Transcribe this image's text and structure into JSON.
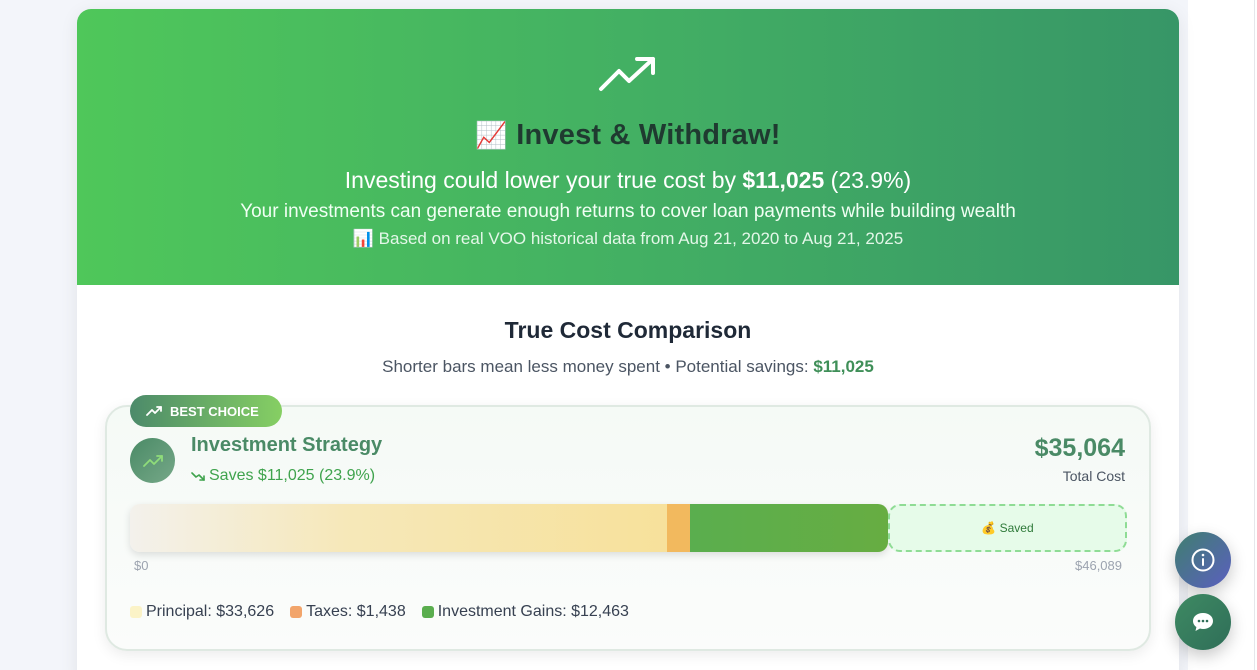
{
  "hero": {
    "emoji": "📈",
    "title": "Invest & Withdraw!",
    "line1_prefix": "Investing could lower your true cost by",
    "line1_amount": "$11,025",
    "line1_pct": "(23.9%)",
    "line2": "Your investments can generate enough returns to cover loan payments while building wealth",
    "line3": "📊 Based on real VOO historical data from Aug 21, 2020 to Aug 21, 2025"
  },
  "comparison": {
    "title": "True Cost Comparison",
    "subtitle": "Shorter bars mean less money spent • Potential savings:",
    "subtitle_amount": "$11,025"
  },
  "strategy": {
    "badge": "BEST CHOICE",
    "name": "Investment Strategy",
    "saves": "Saves $11,025 (23.9%)",
    "cost": "$35,064",
    "cost_label": "Total Cost",
    "saved_label": "💰 Saved",
    "axis_min": "$0",
    "axis_max": "$46,089"
  },
  "bar_values": {
    "max": 46089,
    "principal": 33626,
    "taxes": 1438,
    "gains": 12463,
    "saved": 11025
  },
  "legend": [
    {
      "label": "Principal: $33,626",
      "color": "#fbf3c7"
    },
    {
      "label": "Taxes: $1,438",
      "color": "#f2a56b"
    },
    {
      "label": "Investment Gains: $12,463",
      "color": "#5aae4e"
    }
  ],
  "colors": {
    "accent_green": "#4a8a66",
    "savings_green": "#3fa34d"
  },
  "icons": {
    "hero": "trending-up-icon",
    "info": "info-icon",
    "chat": "chat-icon"
  }
}
